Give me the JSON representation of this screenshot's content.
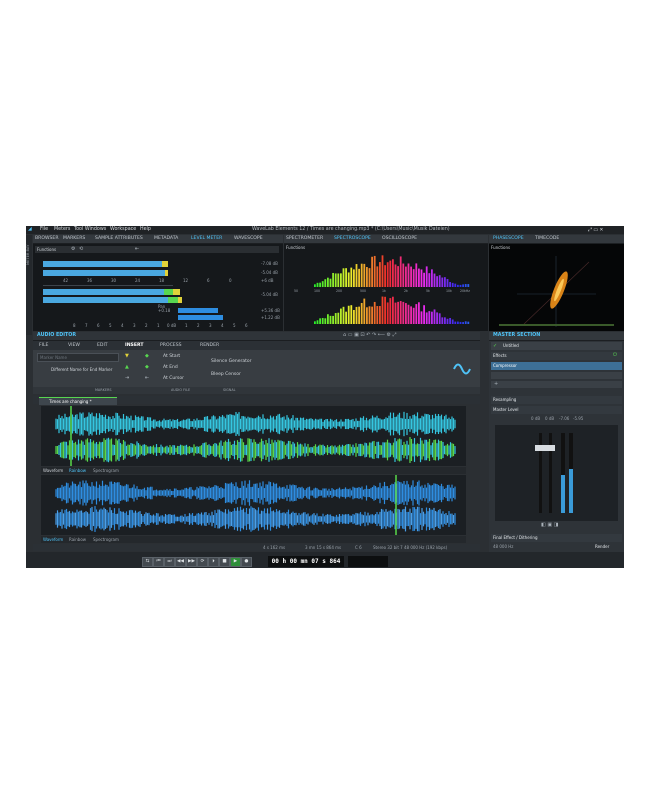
{
  "menu": {
    "items": [
      "File",
      "Meters",
      "Tool Windows",
      "Workspace",
      "Help"
    ],
    "window_title": "WaveLab Elements 12 / Times are changing.mp3 * (C:\\Users\\Music\\Musik Dateien)"
  },
  "side_tab": "METER BAY",
  "top_tabs": {
    "left": [
      "BROWSER",
      "MARKERS",
      "SAMPLE ATTRIBUTES",
      "METADATA",
      "LEVEL METER",
      "WAVESCOPE"
    ],
    "middle": [
      "SPECTROMETER",
      "SPECTROSCOPE",
      "OSCILLOSCOPE"
    ],
    "right": [
      "PHASESCOPE",
      "TIMECODE"
    ]
  },
  "functions_label": "Functions",
  "level_meter": {
    "scale_top": [
      "42",
      "36",
      "30",
      "24",
      "18",
      "12",
      "6",
      "0"
    ],
    "scale_bottom": [
      "8",
      "7",
      "6",
      "5",
      "4",
      "3",
      "2",
      "1",
      "0 dB",
      "1",
      "2",
      "3",
      "4",
      "5",
      "6"
    ],
    "readouts_right": [
      "-7.08 dB",
      "-5.04 dB",
      "+6 dB",
      "-5.04 dB"
    ],
    "pan_label": "Pan",
    "pan_readouts": [
      "+0.18",
      "+5.36 dB",
      "+1.22 dB"
    ]
  },
  "spectrum_freqs": [
    "50",
    "100",
    "200",
    "500",
    "1k",
    "2k",
    "5k",
    "10k",
    "20kHz"
  ],
  "audio_editor": {
    "title": "AUDIO EDITOR",
    "ribbon_tabs": [
      "FILE",
      "VIEW",
      "EDIT",
      "INSERT",
      "PROCESS",
      "RENDER"
    ],
    "marker_fields": [
      "Marker Name",
      "Different Name for End Marker"
    ],
    "section_labels": [
      "MARKERS",
      "AUDIO FILE",
      "SIGNAL"
    ],
    "insert_items": [
      "At Start",
      "At End",
      "At Cursor"
    ],
    "signal_items": [
      "Silence Generator",
      "Bleep Censor"
    ],
    "file_tab": "Times are changing *",
    "view_modes": [
      "Waveform",
      "Rainbow",
      "Spectrogram"
    ],
    "status": [
      "4 s 162 ms",
      "3 mn 15 s 864 ms",
      "C 6",
      "Stereo 32 bit 7 48 000 Hz (192 kbps)"
    ],
    "time_display": "00 h 00 mn 07 s 864 ms"
  },
  "master_section": {
    "title": "MASTER SECTION",
    "preset": "Untitled",
    "effects_label": "Effects",
    "effect_slot": "Compressor",
    "resampling": "Resampling",
    "master_level": "Master Level",
    "level_values": [
      "0 dB",
      "0 dB",
      "-7.06",
      "-5.95"
    ],
    "final_effect": "Final Effect / Dithering",
    "sample_rate": "48 000 Hz",
    "render_label": "Render"
  },
  "colors": {
    "accent": "#4fc3f7",
    "wave_cyan": "#35c6e0",
    "wave_green": "#59d94a",
    "wave_blue": "#2e8de0",
    "meter_green": "#58d650",
    "meter_yellow": "#e0d23a"
  }
}
